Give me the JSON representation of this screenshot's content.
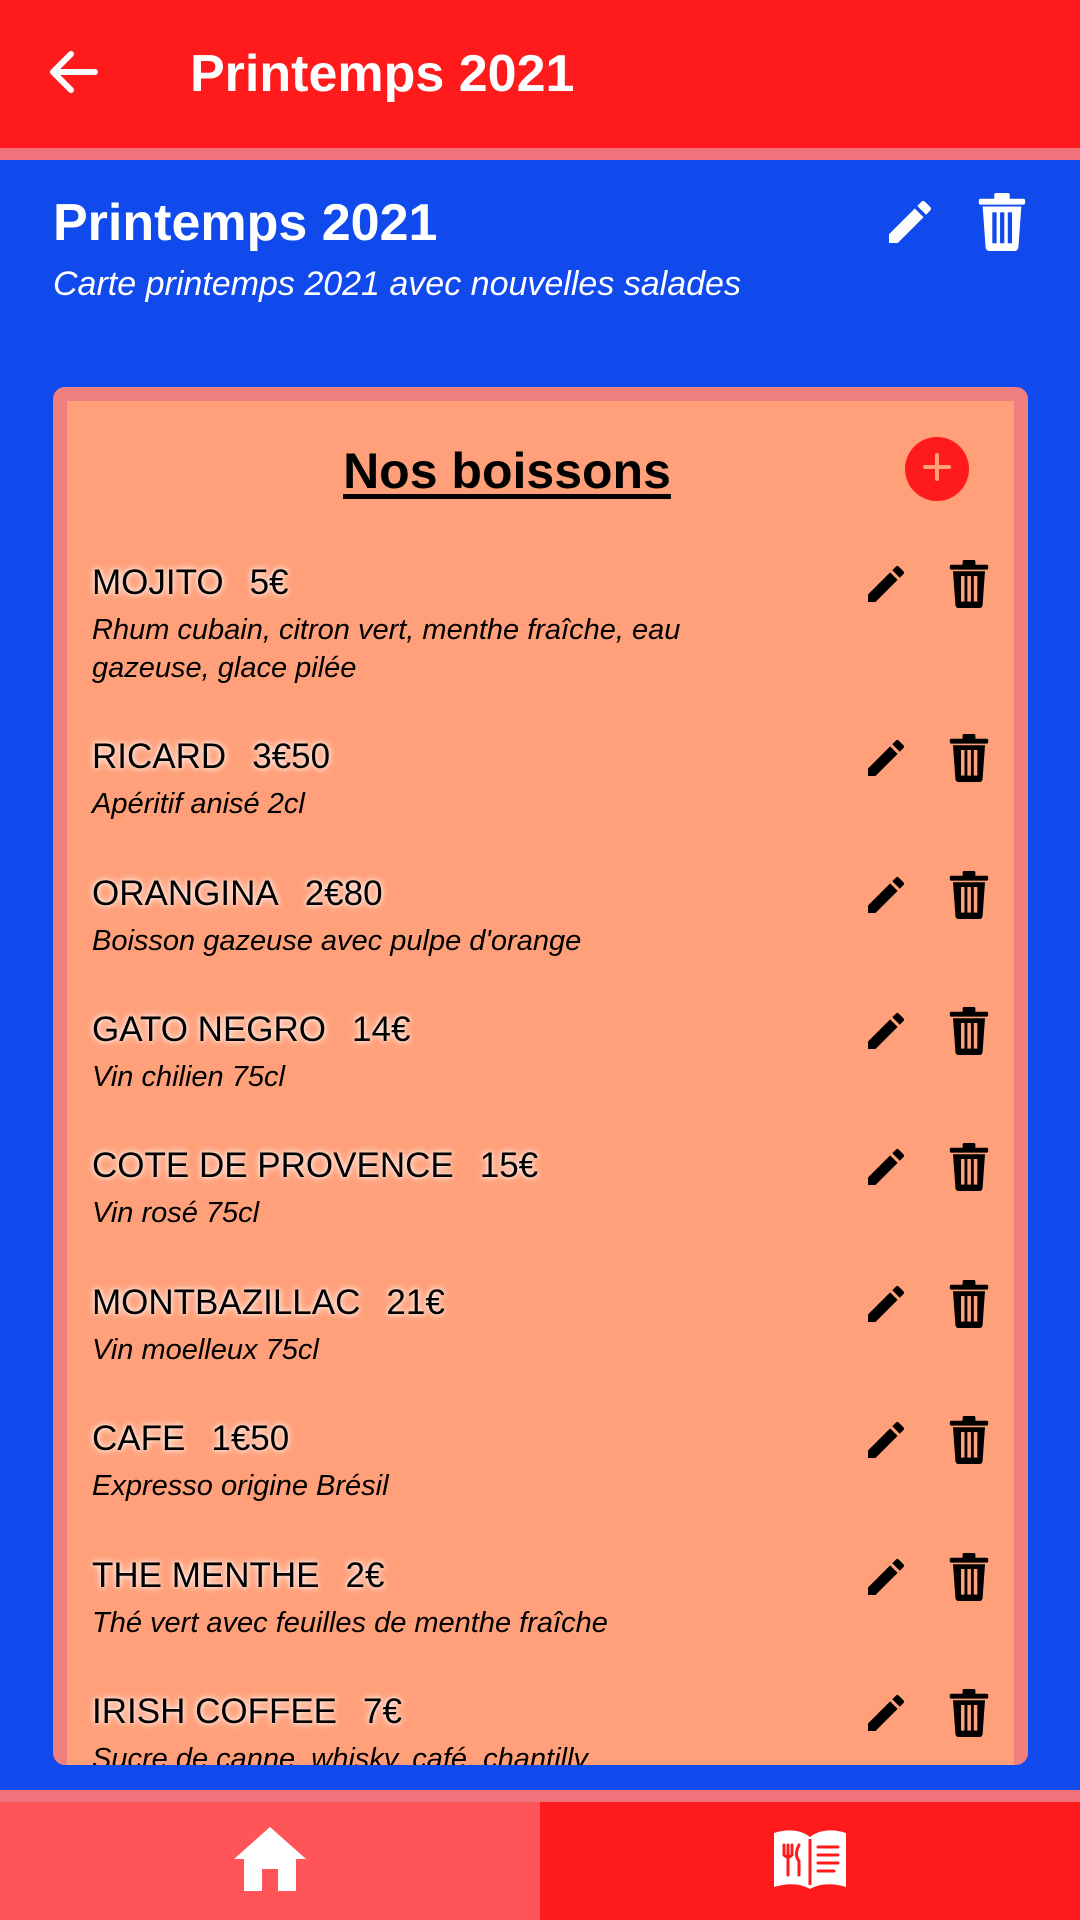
{
  "app_bar": {
    "title": "Printemps 2021",
    "back_icon": "arrow-left-icon"
  },
  "menu": {
    "title": "Printemps 2021",
    "subtitle": "Carte printemps 2021 avec nouvelles salades",
    "edit_icon": "pencil-icon",
    "delete_icon": "trash-icon"
  },
  "section": {
    "title": "Nos boissons",
    "add_icon": "plus-icon",
    "items": [
      {
        "name": "MOJITO",
        "price": "5€",
        "description": "Rhum cubain, citron vert, menthe fraîche, eau gazeuse, glace pilée"
      },
      {
        "name": "RICARD",
        "price": "3€50",
        "description": "Apéritif anisé 2cl"
      },
      {
        "name": "ORANGINA",
        "price": "2€80",
        "description": "Boisson gazeuse avec pulpe d'orange"
      },
      {
        "name": "GATO NEGRO",
        "price": "14€",
        "description": "Vin chilien 75cl"
      },
      {
        "name": "COTE DE PROVENCE",
        "price": "15€",
        "description": "Vin rosé 75cl"
      },
      {
        "name": "MONTBAZILLAC",
        "price": "21€",
        "description": "Vin moelleux 75cl"
      },
      {
        "name": "CAFE",
        "price": "1€50",
        "description": "Expresso origine Brésil"
      },
      {
        "name": "THE MENTHE",
        "price": "2€",
        "description": "Thé vert avec feuilles de menthe fraîche"
      },
      {
        "name": "IRISH COFFEE",
        "price": "7€",
        "description": "Sucre de canne, whisky, café, chantilly"
      }
    ]
  },
  "bottom_nav": {
    "home_icon": "home-icon",
    "menu_icon": "menu-book-icon"
  },
  "colors": {
    "app_bar": "#ff1a1c",
    "background": "#1049ec",
    "card_border": "#f08080",
    "card_fill": "#ffa07a",
    "nav_home": "#ff5558",
    "nav_menu": "#ff1a1c"
  }
}
